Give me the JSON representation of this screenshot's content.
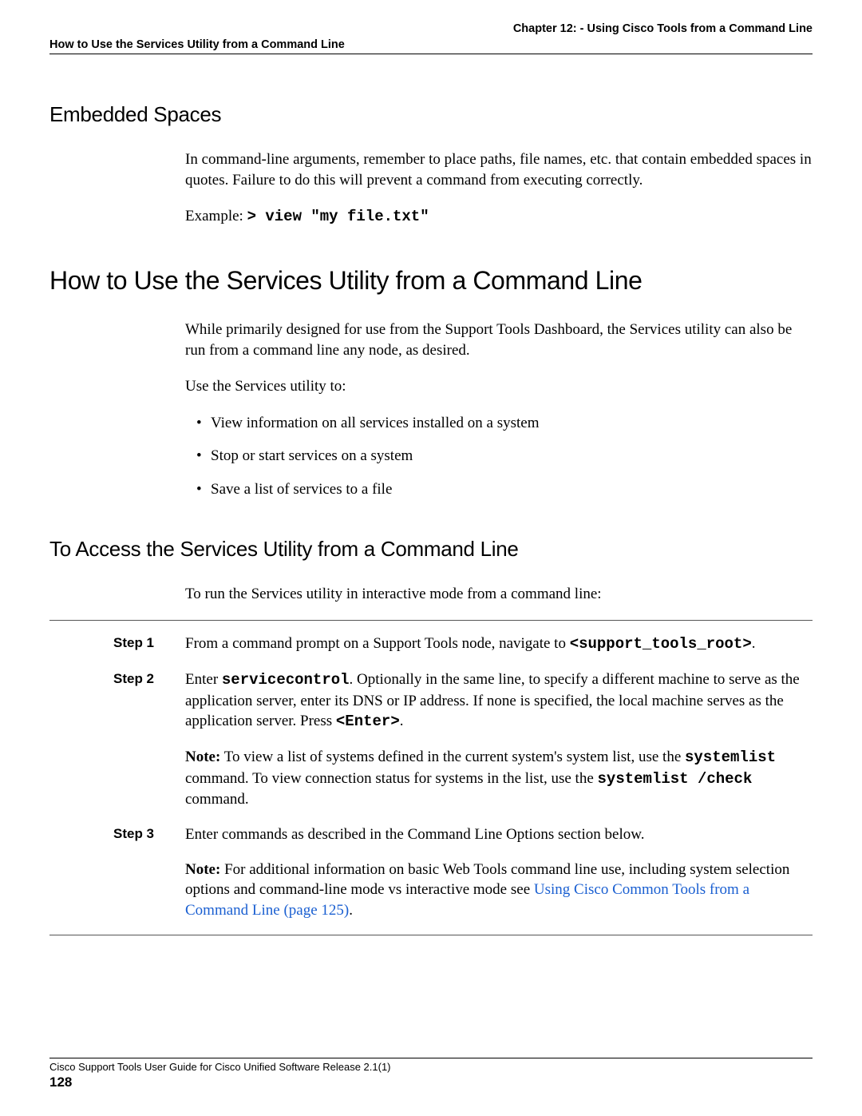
{
  "header": {
    "chapter": "Chapter 12: - Using Cisco Tools from a Command Line",
    "section": "How to Use the Services Utility from a Command Line"
  },
  "embedded_spaces": {
    "heading": "Embedded Spaces",
    "para": "In command-line arguments, remember to place paths, file names, etc. that contain embedded spaces in quotes. Failure to do this will prevent a command from executing correctly.",
    "example_label": "Example: ",
    "example_code": "> view \"my file.txt\""
  },
  "services_utility": {
    "heading": "How to Use the Services Utility from a Command Line",
    "intro": "While primarily designed for use from the Support Tools Dashboard, the Services utility can also be run from a command line any node, as desired.",
    "use_label": "Use the Services utility to:",
    "bullets": [
      "View information on all services installed on a system",
      "Stop or start services on a system",
      "Save a list of services to a file"
    ]
  },
  "access": {
    "heading": "To Access the Services Utility from a Command Line",
    "intro": "To run the Services utility in interactive mode from a command line:",
    "steps": [
      {
        "label": "Step 1",
        "text_before": "From a command prompt on a Support Tools node, navigate to ",
        "code": "<support_tools_root>",
        "text_after": "."
      },
      {
        "label": "Step 2",
        "text_before": "Enter ",
        "code1": "servicecontrol",
        "text_mid": ". Optionally in the same line, to specify a different machine to serve as the application server, enter its DNS or IP address. If none is specified, the local machine serves as the application server. Press ",
        "code2": "<Enter>",
        "text_after": ".",
        "note_label": "Note:",
        "note_before": " To view a list of systems defined in the current system's system list, use the ",
        "note_code1": "systemlist",
        "note_mid": " command. To view connection status for systems in the list, use the ",
        "note_code2": "systemlist /check",
        "note_after": " command."
      },
      {
        "label": "Step 3",
        "text": "Enter commands as described in the Command Line Options section below.",
        "note_label": "Note:",
        "note_before": " For additional information on basic Web Tools command line use, including system selection options and command-line mode vs interactive mode see ",
        "link_text": "Using Cisco Common Tools from a Command Line (page 125)",
        "note_after": "."
      }
    ]
  },
  "footer": {
    "title": "Cisco Support Tools User Guide for Cisco Unified Software Release 2.1(1)",
    "page": "128"
  }
}
